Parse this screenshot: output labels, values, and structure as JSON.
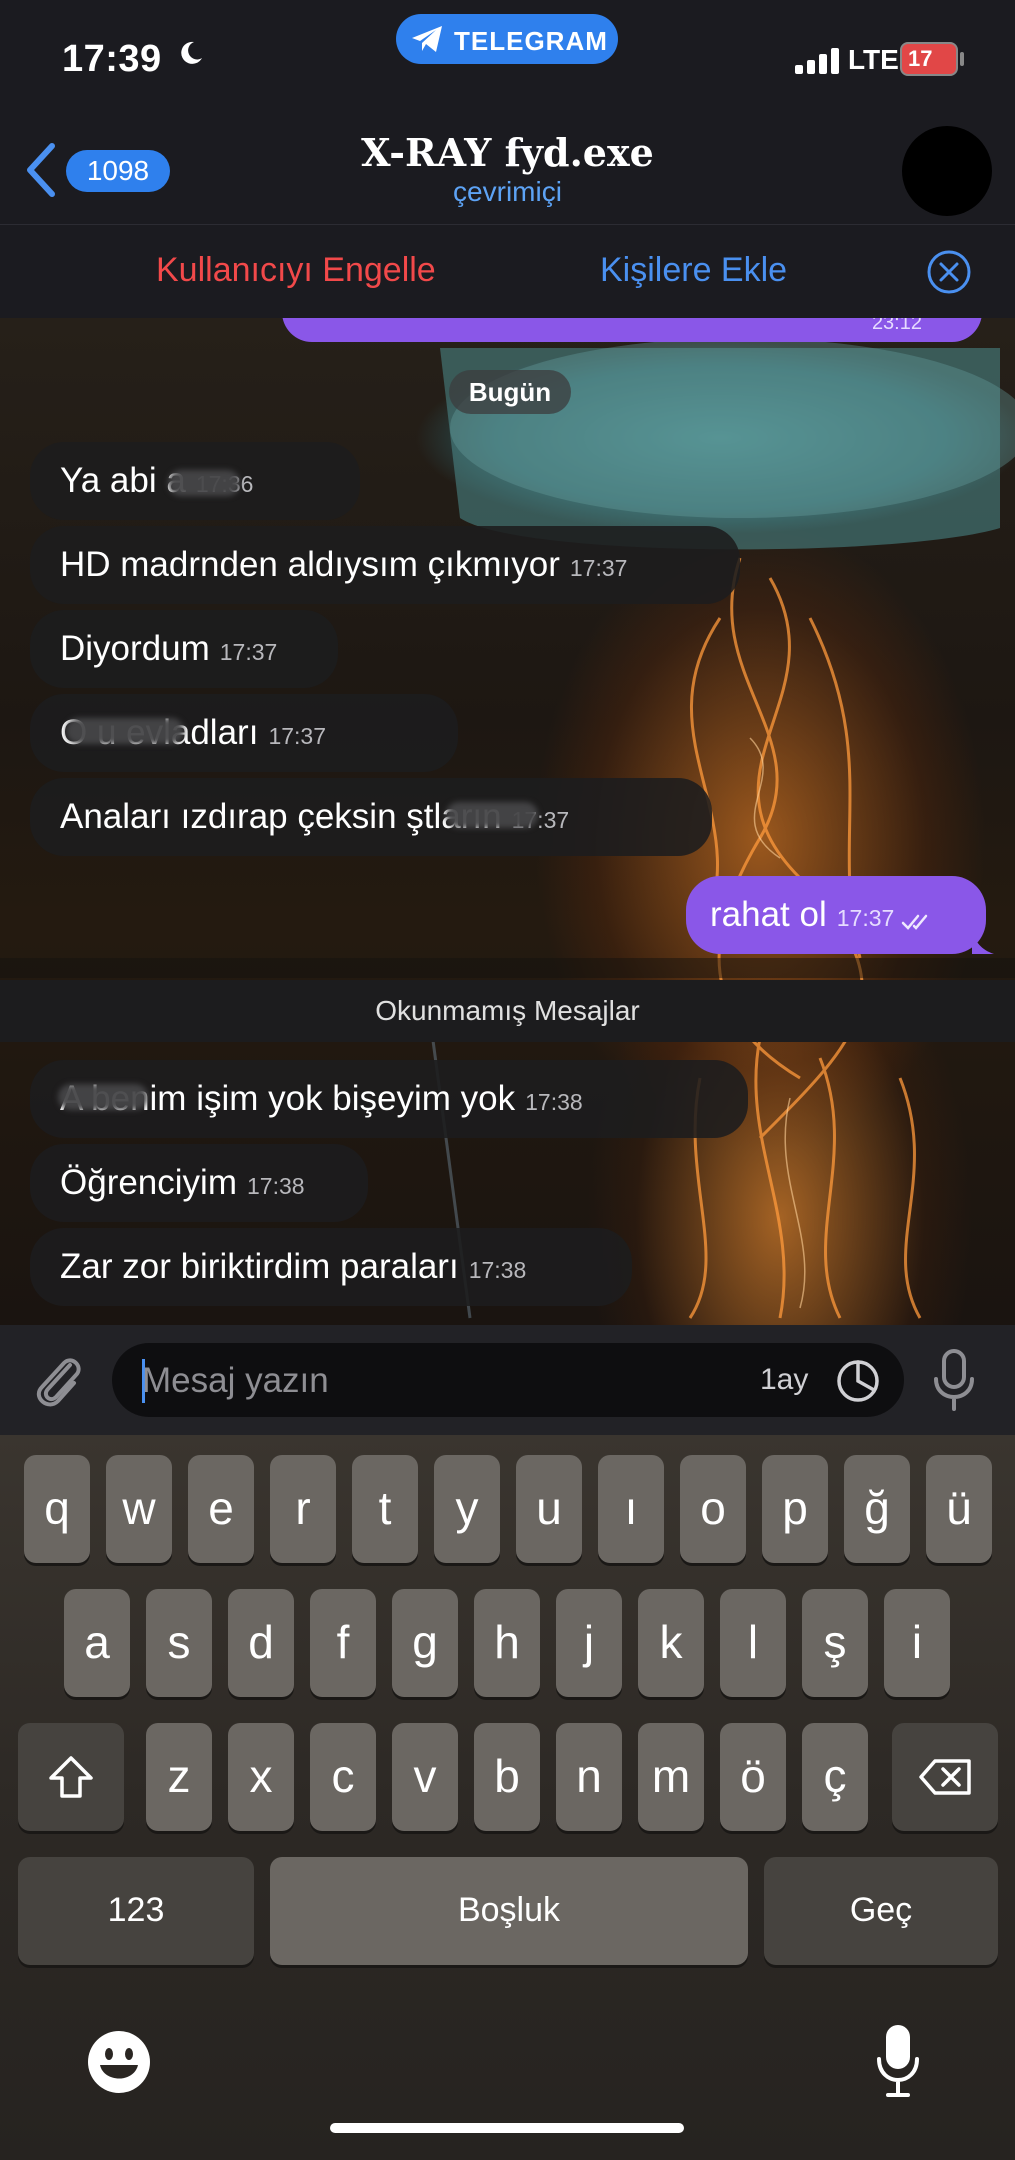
{
  "status_bar": {
    "time": "17:39",
    "carrier_badge": "TELEGRAM",
    "network": "LTE",
    "battery": "17"
  },
  "header": {
    "back_count": "1098",
    "title": "X-RAY fyd.exe",
    "subtitle": "çevrimiçi"
  },
  "action_bar": {
    "block_label": "Kullanıcıyı Engelle",
    "add_contact_label": "Kişilere Ekle"
  },
  "chat": {
    "previous_outgoing_time": "23:12",
    "date_label": "Bugün",
    "messages": [
      {
        "text": "Ya abi a",
        "time": "17:36"
      },
      {
        "text": "HD madrnden aldıysım çıkmıyor",
        "time": "17:37"
      },
      {
        "text": "Diyordum",
        "time": "17:37"
      },
      {
        "text": "O      u evladları",
        "time": "17:37"
      },
      {
        "text": "Anaları ızdırap çeksin    ştların",
        "time": "17:37"
      }
    ],
    "outgoing": {
      "text": "rahat ol",
      "time": "17:37"
    },
    "unread_label": "Okunmamış Mesajlar",
    "unread_messages": [
      {
        "text": "A     benim işim yok bişeyim yok",
        "time": "17:38"
      },
      {
        "text": "Öğrenciyim",
        "time": "17:38"
      },
      {
        "text": "Zar zor biriktirdim paraları",
        "time": "17:38"
      }
    ]
  },
  "input": {
    "placeholder": "Mesaj yazın",
    "timer_label": "1ay"
  },
  "keyboard": {
    "row1": [
      "q",
      "w",
      "e",
      "r",
      "t",
      "y",
      "u",
      "ı",
      "o",
      "p",
      "ğ",
      "ü"
    ],
    "row2": [
      "a",
      "s",
      "d",
      "f",
      "g",
      "h",
      "j",
      "k",
      "l",
      "ş",
      "i"
    ],
    "row3": [
      "z",
      "x",
      "c",
      "v",
      "b",
      "n",
      "m",
      "ö",
      "ç"
    ],
    "numbers_key": "123",
    "space_key": "Boşluk",
    "return_key": "Geç"
  },
  "colors": {
    "accent_blue": "#2f80ed",
    "outgoing_bubble": "#8a57e8",
    "danger_red": "#f2494a",
    "battery_low": "#e14747"
  }
}
